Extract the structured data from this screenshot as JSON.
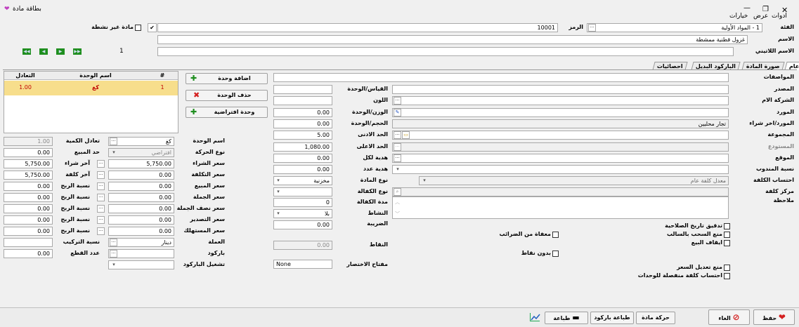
{
  "window": {
    "title": "بطاقة مادة",
    "minimize": "—",
    "maximize": "❐",
    "close": "✕"
  },
  "menu": [
    "ادوات",
    "عرض",
    "خيارات"
  ],
  "header": {
    "category_label": "الفئة",
    "category_value": "1 - المواد الأولية",
    "code_label": "الرمز",
    "code_value": "10001",
    "inactive_label": "مادة غير نشطة",
    "name_label": "الاسم",
    "name_value": "غزول قطنية ممشطة",
    "latin_label": "الاسم اللاتيني",
    "latin_value": "",
    "record_no": "1"
  },
  "tabs": [
    "عام",
    "صورة المادة",
    "الباركود البديل",
    "احصائيات"
  ],
  "left": {
    "specs_label": "المواصفات",
    "specs_value": "",
    "source_label": "المصدر",
    "source_value": "",
    "manufacturer_label": "الشركة الام",
    "manufacturer_value": "",
    "supplier_label": "المورد",
    "supplier_value": "",
    "supplier_last_label": "المورد/اخر شراء",
    "supplier_last_value": "تجار محليين",
    "group_label": "المجموعة",
    "group_value": "",
    "warehouse_label": "المستودع",
    "warehouse_value": "",
    "location_label": "الموقع",
    "location_value": "",
    "rep_label": "نسبة المندوب",
    "rep_value": "",
    "costing_label": "احتساب الكلفة",
    "costing_value": "معدل كلفة عام",
    "costcenter_label": "مركز كلفة",
    "costcenter_value": "",
    "notes_label": "ملاحظة",
    "notes_value": "",
    "checks": [
      "تدقيق تاريخ الصلاحية",
      "منع السحب بالسالب",
      "ايقاف البيع",
      "منع تعديل السعر",
      "احتساب كلفة منفصلة للوحدات"
    ]
  },
  "middle": {
    "size_label": "القياس/الوحدة",
    "size_value": "",
    "color_label": "اللون",
    "color_value": "",
    "weight_label": "الوزن/الوحدة",
    "weight_value": "0.00",
    "volume_label": "الحجم/الوحدة",
    "volume_value": "0.00",
    "min_label": "الحد الادنى",
    "min_value": "5.00",
    "max_label": "الحد الاعلى",
    "max_value": "1,080.00",
    "gift_each_label": "هدية لكل",
    "gift_each_value": "0.00",
    "gift_qty_label": "هدية عدد",
    "gift_qty_value": "0.00",
    "type_label": "نوع المادة",
    "type_value": "مخزنية",
    "warranty_label": "نوع الكفالة",
    "warranty_value": "",
    "warranty_period_label": "مدة الكفالة",
    "warranty_period_value": "0",
    "activity_label": "النشاط",
    "activity_value": "بلا",
    "tax_label": "الضريبة",
    "tax_value": "0.00",
    "tax_exempt_label": "معفاة من الضرائب",
    "points_label": "النقاط",
    "points_value": "0.00",
    "no_points_label": "بدون نقاط",
    "shortcut_label": "مفتاح الاختصار",
    "shortcut_value": "None"
  },
  "units": {
    "headers": [
      "#",
      "اسم الوحدة",
      "التعادل"
    ],
    "rows": [
      {
        "no": "1",
        "name": "كغ",
        "eq": "1.00"
      }
    ],
    "add_button": "اضافة وحدة",
    "delete_button": "حذف الوحدة",
    "default_button": "وحدة افتراضية"
  },
  "unitfields": {
    "unit_name_label": "اسم الوحدة",
    "unit_name_value": "كغ",
    "eq_qty_label": "تعادل الكمية",
    "eq_qty_value": "1.00",
    "move_type_label": "نوع الحركة",
    "move_type_value": "افتراضي",
    "sale_limit_label": "حد المبيع",
    "sale_limit_value": "0.00",
    "purchase_price_label": "سعر الشراء",
    "purchase_price_value": "5,750.00",
    "last_purchase_label": "آخر شراء",
    "last_purchase_value": "5,750.00",
    "cost_price_label": "سعر التكلفة",
    "cost_price_value": "0.00",
    "last_cost_label": "آخر كلفة",
    "last_cost_value": "5,750.00",
    "sale_price_label": "سعر المبيع",
    "sale_price_value": "0.00",
    "wholesale_label": "سعر الجملة",
    "wholesale_value": "0.00",
    "halfwholesale_label": "سعر نصف الجملة",
    "halfwholesale_value": "0.00",
    "export_label": "سعر التصدير",
    "export_value": "0.00",
    "consumer_label": "سعر المستهلك",
    "consumer_value": "0.00",
    "profit_label": "نسبة الربح",
    "profit_values": [
      "0.00",
      "0.00",
      "0.00",
      "0.00",
      "0.00"
    ],
    "currency_label": "العملة",
    "currency_value": "دينار",
    "assembly_label": "نسبة التركيب",
    "assembly_value": "",
    "barcode_label": "باركود",
    "barcode_value": "",
    "pieces_label": "عدد القطع",
    "pieces_value": "0.00",
    "barcode_op_label": "تشغيل الباركود",
    "barcode_op_value": ""
  },
  "bottom": {
    "save": "حفظ",
    "cancel": "الغاء",
    "movement": "حركة مادة",
    "print_barcode": "طباعة باركود",
    "print": "طباعة"
  },
  "colors": {
    "selected_row": "#f7de8c",
    "nav_green": "#1e8e1e",
    "red": "#d42020"
  }
}
